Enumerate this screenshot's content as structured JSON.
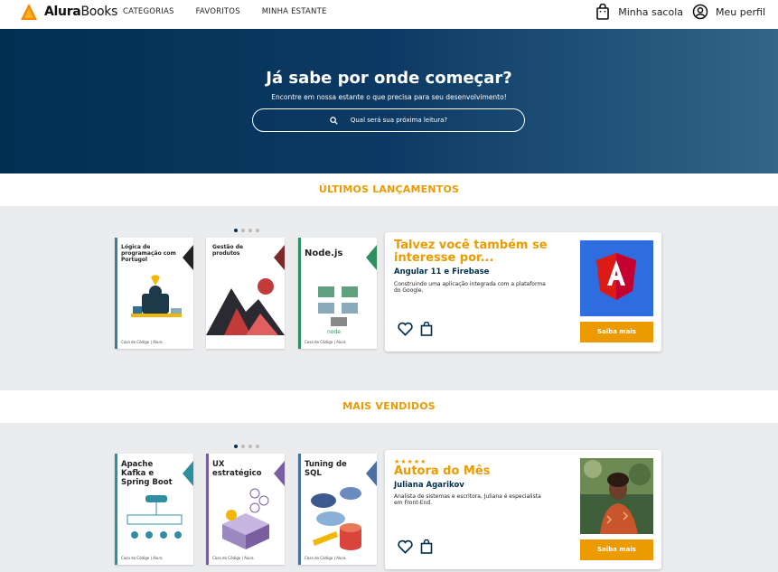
{
  "header": {
    "logo_bold": "Alura",
    "logo_light": "Books",
    "nav": [
      "CATEGORIAS",
      "FAVORITOS",
      "MINHA ESTANTE"
    ],
    "bag_label": "Minha sacola",
    "profile_label": "Meu perfil"
  },
  "hero": {
    "title": "Já sabe por onde começar?",
    "subtitle": "Encontre em nossa estante o que precisa para seu desenvolvimento!",
    "search_placeholder": "Qual será sua próxima leitura?"
  },
  "sections": [
    {
      "title": "ÚLTIMOS LANÇAMENTOS",
      "books": [
        {
          "title": "Lógica de programação com Portugol",
          "spine": "#3b7fa0",
          "brand": "Casa do Código | Alura"
        },
        {
          "title": "Gestão de produtos",
          "spine": "#f0f0f0",
          "brand": "Casa do Código | Alura"
        },
        {
          "title": "Node.js",
          "spine": "#2f8f5f",
          "brand": "Casa do Código | Alura"
        }
      ],
      "card": {
        "stars": "",
        "title": "Talvez você também se interesse por...",
        "subtitle": "Angular 11 e Firebase",
        "description": "Construindo uma aplicação integrada com a plataforma do Google.",
        "button": "Saiba mais"
      }
    },
    {
      "title": "MAIS VENDIDOS",
      "books": [
        {
          "title": "Apache Kafka e Spring Boot",
          "spine": "#2f8fa0",
          "brand": "Casa do Código | Alura"
        },
        {
          "title": "UX estratégico",
          "spine": "#7a5fa0",
          "brand": "Casa do Código | Alura"
        },
        {
          "title": "Tuning de SQL",
          "spine": "#4a6fa0",
          "brand": "Casa do Código | Alura"
        }
      ],
      "card": {
        "stars": "★★★★★",
        "title": "Autora do Mês",
        "subtitle": "Juliana Agarikov",
        "description": "Analista de sistemas e escritora, Juliana é especialista em Front-End.",
        "button": "Saiba mais"
      }
    }
  ],
  "colors": {
    "brand_orange": "#eb9b00",
    "brand_blue": "#002f52",
    "angular_red": "#dd1b16"
  }
}
